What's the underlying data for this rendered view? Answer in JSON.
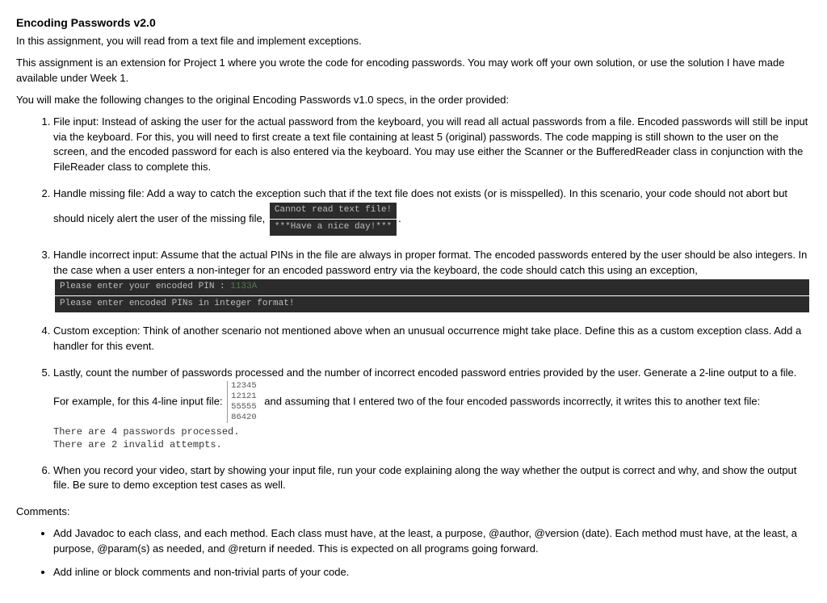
{
  "title": "Encoding Passwords v2.0",
  "intro1": "In this assignment, you will read from a text file and implement exceptions.",
  "intro2": "This assignment is an extension for Project 1 where you wrote the code for encoding passwords. You may work off your own solution, or use the solution I have made available under Week 1.",
  "intro3": "You will make the following changes to the original Encoding Passwords v1.0 specs, in the order provided:",
  "items": {
    "i1": "File input: Instead of asking the user for the actual password from the keyboard, you will read all actual passwords from a file. Encoded passwords will still be input via the keyboard. For this, you will need to first create a text file containing at least 5 (original) passwords. The code mapping is still shown to the user on the screen, and the encoded password for each is also entered via the keyboard. You may use either the Scanner or the BufferedReader class in conjunction with the FileReader class to complete this.",
    "i2_a": "Handle missing file: Add a way to catch the exception such that if the text file does not exists (or is misspelled). In this scenario, your code should not abort but should nicely alert the user of the missing file, ",
    "i2_code1": "Cannot read text file!",
    "i2_code2": "***Have a nice day!***",
    "i2_b": ".",
    "i3_a": "Handle incorrect input: Assume that the actual PINs in the file are always in proper format. The encoded passwords entered by the user should be also integers. In the case when a user enters a non-integer for an encoded password entry via the keyboard, the code should catch this using an exception, ",
    "i3_code1a": "Please enter your encoded PIN : ",
    "i3_code1b": "1133A",
    "i3_code2": "Please enter encoded PINs in integer format!",
    "i3_b": ".",
    "i4": "Custom exception: Think of another scenario not mentioned above when an unusual occurrence might take place. Define this as a custom exception class. Add a handler for this event.",
    "i5_a": "Lastly, count the number of passwords processed and the number of incorrect encoded password entries provided by the user. Generate a 2-line output to a file. For example, for this 4-line input file: ",
    "i5_file": [
      "12345",
      "12121",
      "55555",
      "86420"
    ],
    "i5_b": " and assuming that I entered two of the four encoded passwords incorrectly, it writes this to another text file:",
    "i5_out1": "There are 4 passwords processed.",
    "i5_out2": "There are 2 invalid attempts.",
    "i6": "When you record your video, start by showing your input file, run your code explaining along the way whether the output is correct and why, and show the output file. Be sure to demo exception test cases as well."
  },
  "comments_label": "Comments:",
  "comments": {
    "c1": "Add Javadoc to each class, and each method. Each class must have, at the least, a purpose, @author, @version (date). Each method must have, at the least, a purpose, @param(s) as needed, and @return if needed. This is expected on all programs going forward.",
    "c2": "Add inline or block comments and non-trivial parts of your code."
  }
}
